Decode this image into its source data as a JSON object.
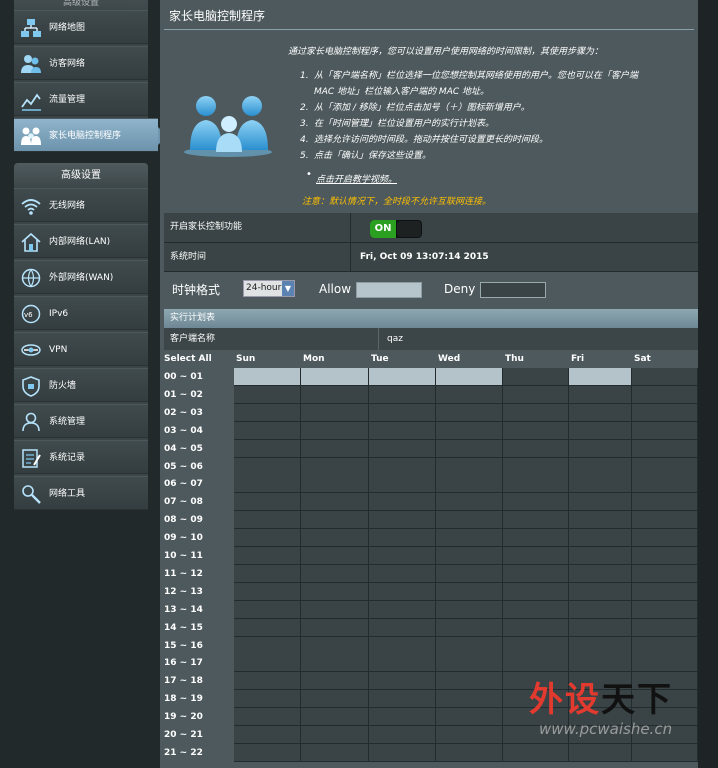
{
  "sidebar": {
    "top_group_title": "高级设置",
    "top_items": [
      {
        "label": "网络地图",
        "icon": "network-map-icon"
      },
      {
        "label": "访客网络",
        "icon": "guest-network-icon"
      },
      {
        "label": "流量管理",
        "icon": "traffic-manager-icon"
      },
      {
        "label": "家长电脑控制程序",
        "icon": "parental-control-icon",
        "active": true
      }
    ],
    "advanced_title": "高级设置",
    "advanced_items": [
      {
        "label": "无线网络",
        "icon": "wireless-icon"
      },
      {
        "label": "内部网络(LAN)",
        "icon": "lan-house-icon"
      },
      {
        "label": "外部网络(WAN)",
        "icon": "wan-globe-icon"
      },
      {
        "label": "IPv6",
        "icon": "ipv6-globe-icon"
      },
      {
        "label": "VPN",
        "icon": "vpn-icon"
      },
      {
        "label": "防火墙",
        "icon": "firewall-shield-icon"
      },
      {
        "label": "系统管理",
        "icon": "admin-user-icon"
      },
      {
        "label": "系统记录",
        "icon": "system-log-icon"
      },
      {
        "label": "网络工具",
        "icon": "network-tools-icon"
      }
    ]
  },
  "main": {
    "title": "家长电脑控制程序",
    "intro": "通过家长电脑控制程序，您可以设置用户使用网络的时间限制，其使用步骤为：",
    "steps": [
      {
        "num": "1.",
        "lines": [
          "从「客户端名称」栏位选择一位您想控制其网络使用的用户。您也可以在「客户端",
          "MAC 地址」栏位输入客户端的 MAC 地址。"
        ]
      },
      {
        "num": "2.",
        "lines": [
          "从「添加 / 移除」栏位点击加号（＋）图标新增用户。"
        ]
      },
      {
        "num": "3.",
        "lines": [
          "在「时间管理」栏位设置用户的实行计划表。"
        ]
      },
      {
        "num": "4.",
        "lines": [
          "选择允许访问的时间段。拖动并按住可设置更长的时间段。"
        ]
      },
      {
        "num": "5.",
        "lines": [
          "点击「确认」保存这些设置。"
        ]
      }
    ],
    "video_bullet": "•",
    "video_link": "点击开启教学视频。",
    "note": "注意：默认情况下，全时段不允许互联网连接。",
    "enable_label": "开启家长控制功能",
    "toggle_on": "ON",
    "time_label": "系统时间",
    "time_value": "Fri, Oct 09 13:07:14 2015",
    "clock_label": "时钟格式",
    "clock_value": "24-hour",
    "clock_arrow": "▼",
    "allow_label": "Allow",
    "deny_label": "Deny",
    "allow_color": "#b3c3c9",
    "deny_color": "#3a4446",
    "schedule_header": "实行计划表",
    "client_name_label": "客户端名称",
    "client_name_value": "qaz"
  },
  "schedule": {
    "select_all": "Select All",
    "days": [
      "Sun",
      "Mon",
      "Tue",
      "Wed",
      "Thu",
      "Fri",
      "Sat"
    ],
    "hours": [
      "00 ~ 01",
      "01 ~ 02",
      "02 ~ 03",
      "03 ~ 04",
      "04 ~ 05",
      "05 ~ 06",
      "06 ~ 07",
      "07 ~ 08",
      "08 ~ 09",
      "09 ~ 10",
      "10 ~ 11",
      "11 ~ 12",
      "12 ~ 13",
      "13 ~ 14",
      "14 ~ 15",
      "15 ~ 16",
      "16 ~ 17",
      "17 ~ 18",
      "18 ~ 19",
      "19 ~ 20",
      "20 ~ 21",
      "21 ~ 22"
    ],
    "allowed": [
      [
        0,
        0
      ],
      [
        0,
        1
      ],
      [
        0,
        2
      ],
      [
        0,
        3
      ],
      [
        0,
        5
      ]
    ]
  },
  "watermark": {
    "big": "外设天下",
    "small": "www.pcwaishe.cn"
  }
}
